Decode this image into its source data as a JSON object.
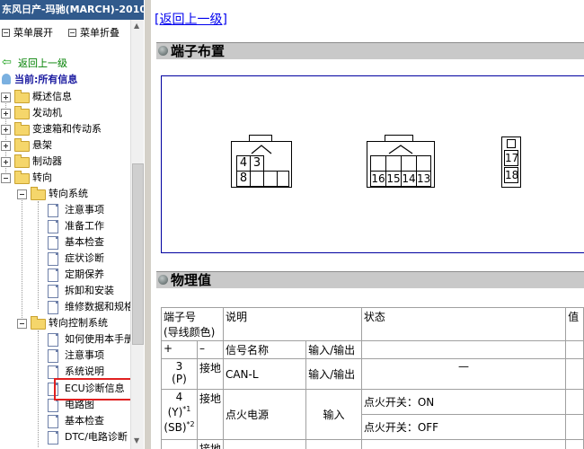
{
  "window_title": "东风日产-玛驰(MARCH)-2010-",
  "menu": {
    "expand": "菜单展开",
    "collapse": "菜单折叠"
  },
  "tree": {
    "back": "返回上一级",
    "current": "当前:所有信息",
    "items": [
      {
        "label": "概述信息"
      },
      {
        "label": "发动机"
      },
      {
        "label": "变速箱和传动系"
      },
      {
        "label": "悬架"
      },
      {
        "label": "制动器"
      },
      {
        "label": "转向"
      },
      {
        "label": "转向系统"
      },
      {
        "label": "注意事项"
      },
      {
        "label": "准备工作"
      },
      {
        "label": "基本检查"
      },
      {
        "label": "症状诊断"
      },
      {
        "label": "定期保养"
      },
      {
        "label": "拆卸和安装"
      },
      {
        "label": "维修数据和规格"
      },
      {
        "label": "转向控制系统"
      },
      {
        "label": "如何使用本手册"
      },
      {
        "label": "注意事项"
      },
      {
        "label": "系统说明"
      },
      {
        "label": "ECU诊断信息"
      },
      {
        "label": "电路图"
      },
      {
        "label": "基本检查"
      },
      {
        "label": "DTC/电路诊断"
      }
    ]
  },
  "content": {
    "back_link": "[返回上一级]",
    "section_terminal": "端子布置",
    "section_physical": "物理值",
    "connectors": {
      "a": [
        "4",
        "3",
        "8"
      ],
      "b": [
        "16",
        "15",
        "14",
        "13"
      ],
      "c": [
        "17",
        "18"
      ]
    },
    "table": {
      "h_terminal": "端子号",
      "h_terminal_sub": "(导线颜色)",
      "h_desc": "说明",
      "h_state": "状态",
      "h_value": "值",
      "h_plus": "+",
      "h_minus": "–",
      "h_signal": "信号名称",
      "h_io": "输入/输出",
      "row1": {
        "no": "3",
        "color": "(P)",
        "minus": "接地",
        "signal": "CAN-L",
        "io": "输入/输出",
        "state": "—"
      },
      "row2": {
        "no": "4",
        "color1": "(Y)",
        "sup1": "*1",
        "color2": "(SB)",
        "sup2": "*2",
        "minus": "接地",
        "signal": "点火电源",
        "io": "输入",
        "state_on": "点火开关：ON",
        "state_off": "点火开关：OFF"
      },
      "row3": {
        "minus": "接地"
      }
    }
  }
}
